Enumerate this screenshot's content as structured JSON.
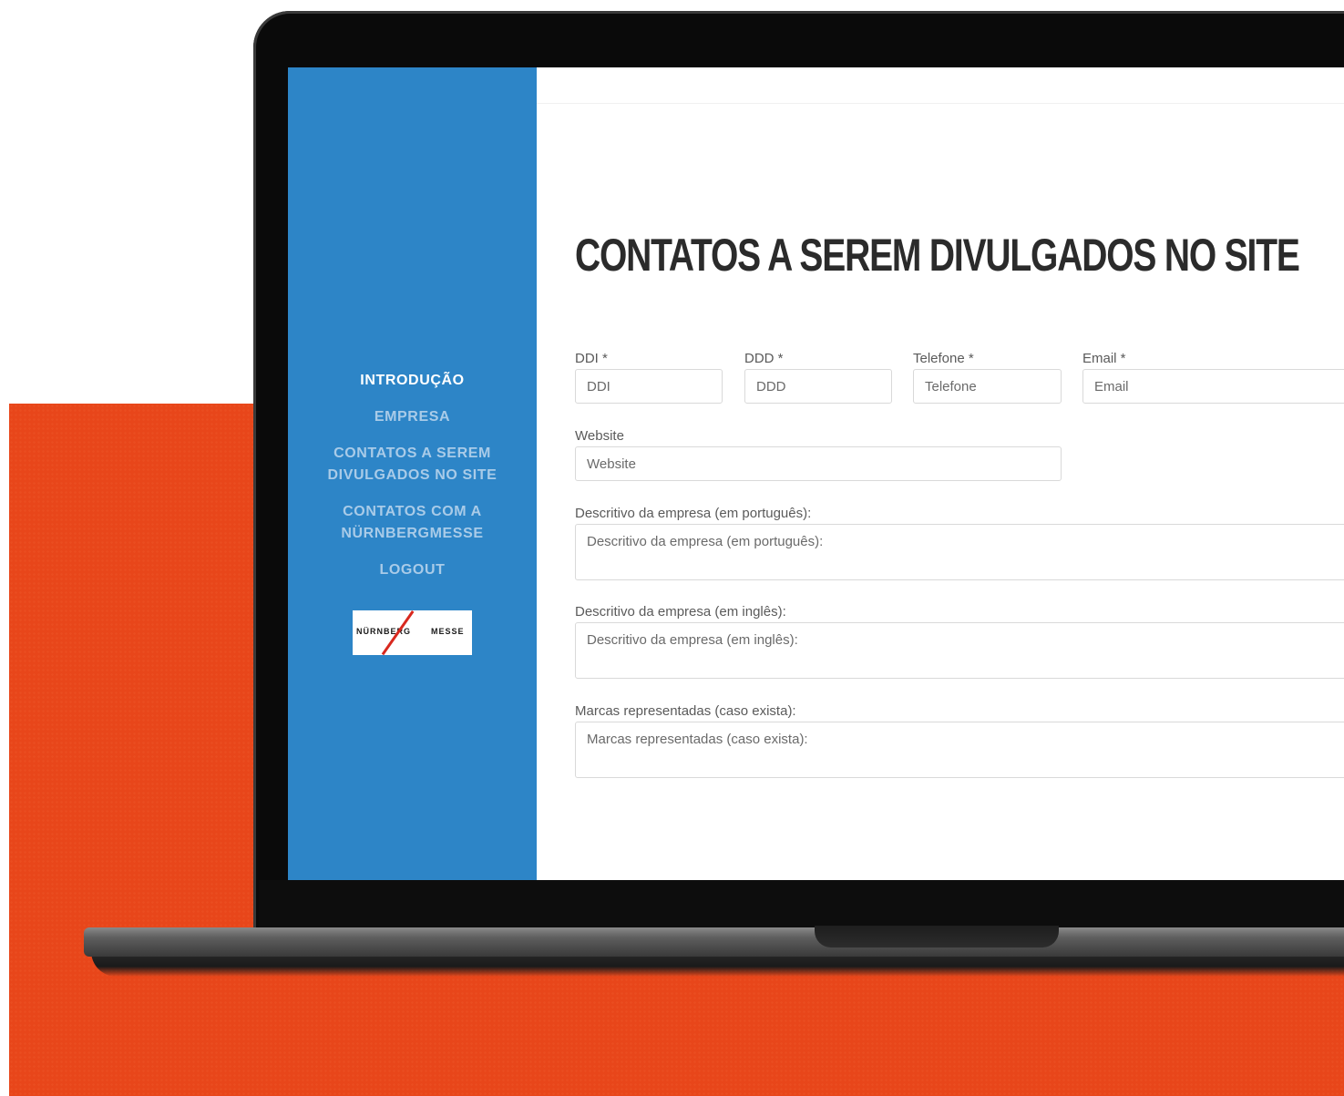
{
  "sidebar": {
    "items": [
      {
        "label": "INTRODUÇÃO",
        "active": true
      },
      {
        "label": "EMPRESA",
        "active": false
      },
      {
        "label": "CONTATOS A SEREM DIVULGADOS NO SITE",
        "active": false
      },
      {
        "label": "CONTATOS COM A NÜRNBERGMESSE",
        "active": false
      },
      {
        "label": "LOGOUT",
        "active": false
      }
    ],
    "logo": {
      "left": "NÜRNBERG",
      "right": "MESSE"
    }
  },
  "main": {
    "title": "CONTATOS A SEREM DIVULGADOS NO SITE",
    "fields": {
      "ddi": {
        "label": "DDI *",
        "placeholder": "DDI"
      },
      "ddd": {
        "label": "DDD *",
        "placeholder": "DDD"
      },
      "telefone": {
        "label": "Telefone *",
        "placeholder": "Telefone"
      },
      "email": {
        "label": "Email *",
        "placeholder": "Email"
      },
      "website": {
        "label": "Website",
        "placeholder": "Website"
      },
      "desc_pt": {
        "label": "Descritivo da empresa (em português):",
        "placeholder": "Descritivo da empresa (em português):"
      },
      "desc_en": {
        "label": "Descritivo da empresa (em inglês):",
        "placeholder": "Descritivo da empresa (em inglês):"
      },
      "marcas": {
        "label": "Marcas representadas (caso exista):",
        "placeholder": "Marcas representadas (caso exista):"
      }
    }
  },
  "colors": {
    "sidebar": "#2d85c7",
    "background_accent": "#e8461a",
    "title": "#2b2b2b"
  }
}
